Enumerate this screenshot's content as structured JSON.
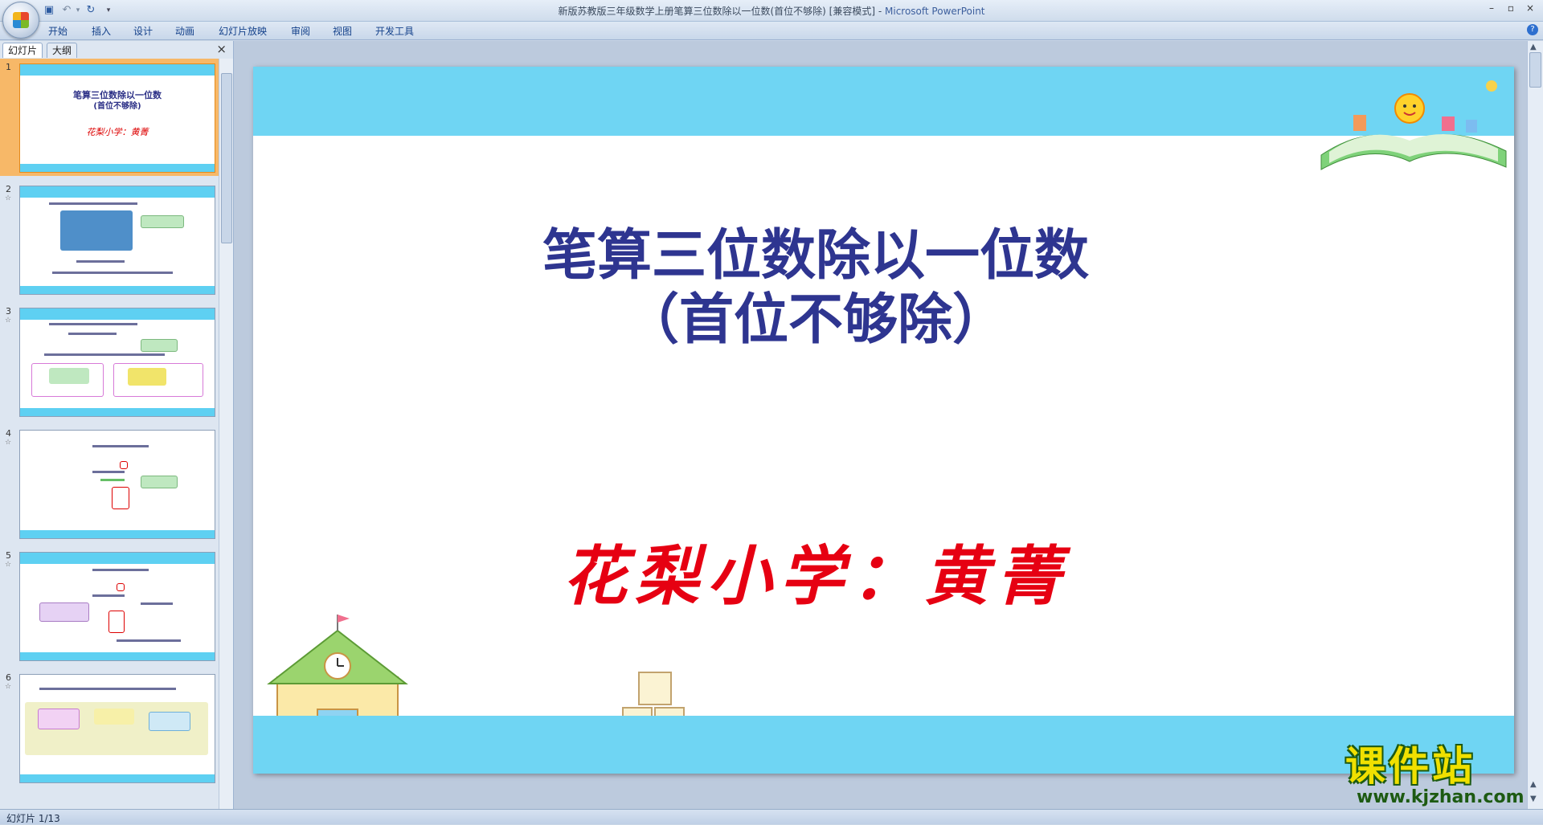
{
  "window": {
    "title_doc": "新版苏教版三年级数学上册笔算三位数除以一位数(首位不够除) [兼容模式] - ",
    "title_app": "Microsoft PowerPoint",
    "minimize": "–",
    "restore": "▫",
    "close": "×"
  },
  "ribbon": {
    "tabs": [
      "开始",
      "插入",
      "设计",
      "动画",
      "幻灯片放映",
      "审阅",
      "视图",
      "开发工具"
    ],
    "help": "?"
  },
  "left_pane": {
    "tab_slides": "幻灯片",
    "tab_outline": "大纲",
    "close": "×",
    "slides": [
      {
        "num": "1",
        "selected": true,
        "title_line1": "笔算三位数除以一位数",
        "title_line2": "(首位不够除)",
        "author": "花梨小学：黄菁"
      },
      {
        "num": "2",
        "selected": false
      },
      {
        "num": "3",
        "selected": false
      },
      {
        "num": "4",
        "selected": false
      },
      {
        "num": "5",
        "selected": false
      },
      {
        "num": "6",
        "selected": false
      }
    ],
    "star": "☆"
  },
  "slide": {
    "title_line1": "笔算三位数除以一位数",
    "title_line2": "（首位不够除）",
    "author": "花梨小学：黄菁",
    "colors": {
      "band": "#6fd5f3",
      "title": "#2e3590",
      "author": "#e60012"
    }
  },
  "status": {
    "text": "幻灯片 1/13"
  },
  "watermark": {
    "main": "课件站",
    "url": "www.kjzhan.com"
  }
}
